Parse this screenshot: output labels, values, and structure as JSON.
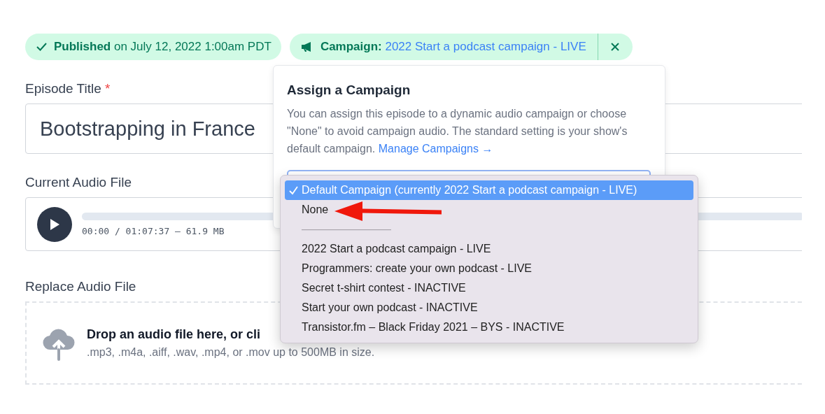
{
  "status_badges": [
    {
      "kind": "published",
      "label": "Published",
      "text": "on July 12, 2022 1:00am PDT"
    },
    {
      "kind": "campaign",
      "label": "Campaign:",
      "text": "2022 Start a podcast campaign - LIVE"
    }
  ],
  "episode_title": {
    "label": "Episode Title",
    "required_mark": "*",
    "value": "Bootstrapping in France"
  },
  "current_audio": {
    "label": "Current Audio File",
    "time": "00:00 / 01:07:37 — 61.9 MB"
  },
  "replace_audio": {
    "label": "Replace Audio File",
    "prompt": "Drop an audio file here, or cli",
    "hint": ".mp3, .m4a, .aiff, .wav, .mp4, or .mov up to 500MB in size."
  },
  "campaign_popover": {
    "title": "Assign a Campaign",
    "description": "You can assign this episode to a dynamic audio campaign or choose \"None\" to avoid campaign audio. The standard setting is your show's default campaign.",
    "link": "Manage Campaigns →"
  },
  "campaign_menu": {
    "items": [
      {
        "kind": "option",
        "label": "Default Campaign (currently 2022 Start a podcast campaign - LIVE)",
        "selected": true
      },
      {
        "kind": "option",
        "label": "None",
        "selected": false
      },
      {
        "kind": "separator",
        "label": "————————"
      },
      {
        "kind": "option",
        "label": "2022 Start a podcast campaign - LIVE",
        "selected": false
      },
      {
        "kind": "option",
        "label": "Programmers: create your own podcast - LIVE",
        "selected": false
      },
      {
        "kind": "option",
        "label": "Secret t-shirt contest - INACTIVE",
        "selected": false
      },
      {
        "kind": "option",
        "label": "Start your own podcast - INACTIVE",
        "selected": false
      },
      {
        "kind": "option",
        "label": "Transistor.fm – Black Friday 2021 – BYS - INACTIVE",
        "selected": false
      }
    ]
  },
  "annotations": [
    {
      "kind": "arrow"
    }
  ]
}
